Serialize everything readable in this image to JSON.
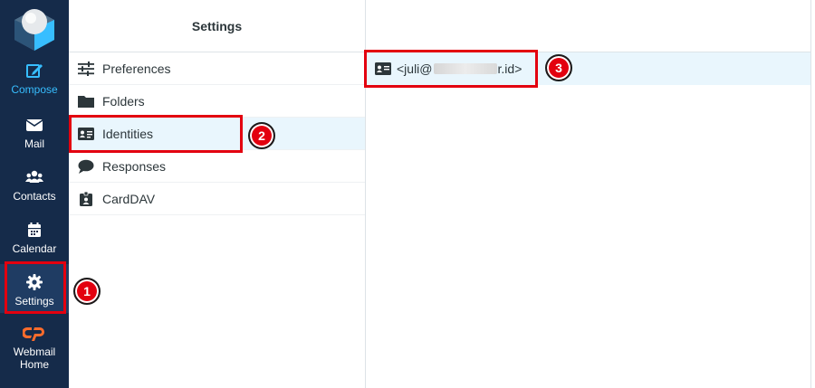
{
  "nav": {
    "items": [
      {
        "key": "compose",
        "label": "Compose",
        "icon": "compose-icon"
      },
      {
        "key": "mail",
        "label": "Mail",
        "icon": "envelope-icon"
      },
      {
        "key": "contacts",
        "label": "Contacts",
        "icon": "users-icon"
      },
      {
        "key": "calendar",
        "label": "Calendar",
        "icon": "calendar-icon"
      },
      {
        "key": "settings",
        "label": "Settings",
        "icon": "gear-icon"
      },
      {
        "key": "webmail-home",
        "label": "Webmail Home",
        "icon": "cpanel-icon"
      }
    ],
    "colors": {
      "background": "#152b4a",
      "accent": "#37beff"
    }
  },
  "settings_panel": {
    "title": "Settings",
    "items": [
      {
        "label": "Preferences",
        "icon": "sliders-icon"
      },
      {
        "label": "Folders",
        "icon": "folder-icon"
      },
      {
        "label": "Identities",
        "icon": "id-card-icon",
        "selected": true
      },
      {
        "label": "Responses",
        "icon": "comment-icon"
      },
      {
        "label": "CardDAV",
        "icon": "badge-icon"
      }
    ]
  },
  "identities_panel": {
    "rows": [
      {
        "prefix": "<juli@",
        "suffix": "r.id>",
        "icon": "id-card-icon"
      }
    ]
  },
  "annotations": {
    "step1": "1",
    "step2": "2",
    "step3": "3",
    "color": "#e3000f"
  }
}
